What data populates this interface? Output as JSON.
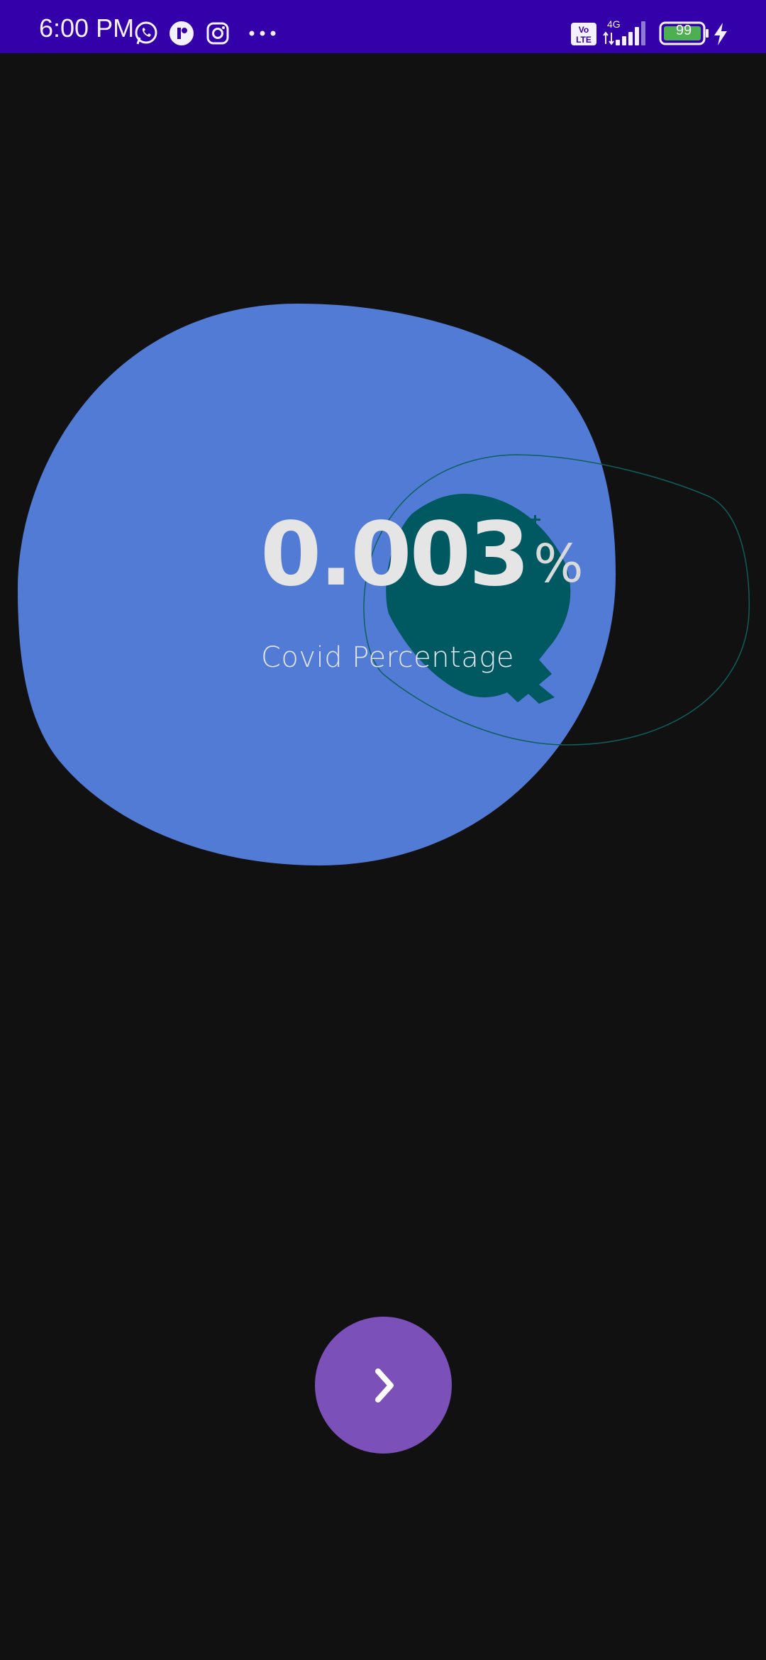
{
  "status_bar": {
    "time": "6:00 PM",
    "network_type": "4G",
    "volte": "Vo LTE",
    "battery": "99",
    "icons": [
      "whatsapp-icon",
      "threads-icon",
      "instagram-icon",
      "more-dots-icon",
      "volte-icon",
      "signal-icon",
      "battery-icon",
      "charging-icon"
    ]
  },
  "main": {
    "percentage_value": "0.003",
    "percent_sign": "%",
    "label": "Covid Percentage"
  },
  "controls": {
    "next_icon": "chevron-right-icon"
  },
  "colors": {
    "status_bar_bg": "#3300AA",
    "background": "#111111",
    "blue_blob": "#527BD6",
    "teal_blob": "#005861",
    "teal_outline": "#0E5F5C",
    "next_button": "#7B50B8",
    "text_primary": "#E5E5E5"
  }
}
